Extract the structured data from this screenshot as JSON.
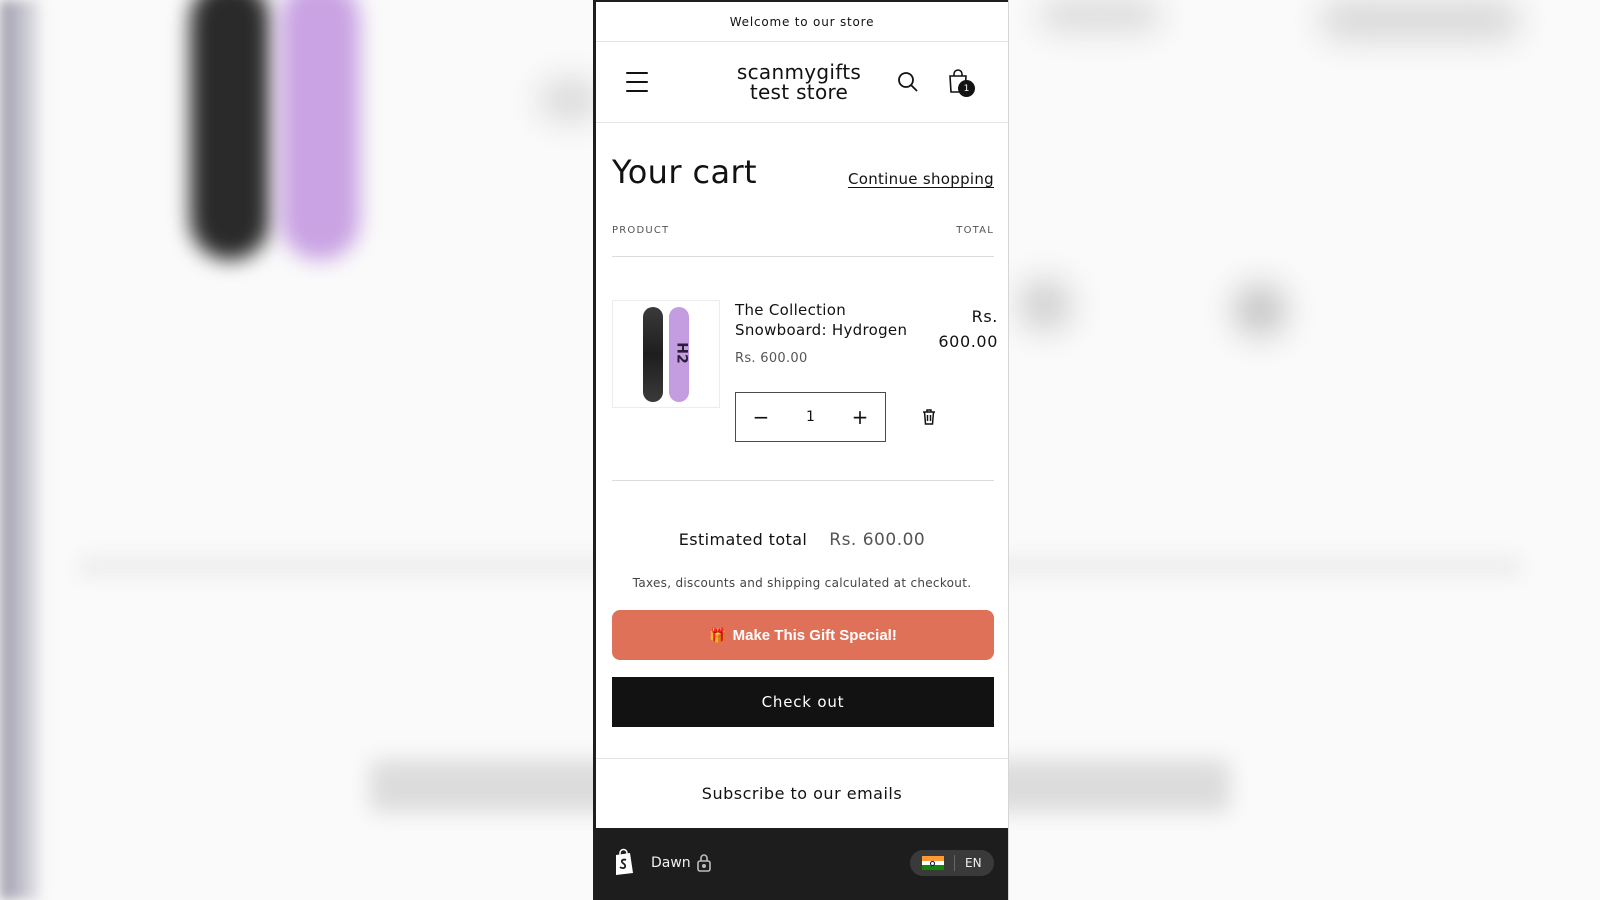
{
  "announcement": {
    "text": "Welcome to our store"
  },
  "header": {
    "store_name": "scanmygifts test store",
    "cart_count": "1"
  },
  "cart": {
    "title": "Your cart",
    "continue_label": "Continue shopping",
    "columns": {
      "product": "PRODUCT",
      "total": "TOTAL"
    },
    "items": [
      {
        "name": "The Collection Snowboard: Hydrogen",
        "unit_price": "Rs. 600.00",
        "line_total": "Rs. 600.00",
        "quantity": "1"
      }
    ],
    "estimated_total_label": "Estimated total",
    "estimated_total_value": "Rs. 600.00",
    "tax_note": "Taxes, discounts and shipping calculated at checkout.",
    "gift_button_label": "Make This Gift Special!",
    "gift_icon": "🎁",
    "checkout_label": "Check out"
  },
  "footer": {
    "subscribe_heading": "Subscribe to our emails"
  },
  "preview_bar": {
    "theme_name": "Dawn",
    "language": "EN",
    "flag": "india-flag-icon"
  },
  "colors": {
    "gift_button": "#de7157",
    "checkout_button": "#121212",
    "preview_bar": "#1d1d1d"
  }
}
